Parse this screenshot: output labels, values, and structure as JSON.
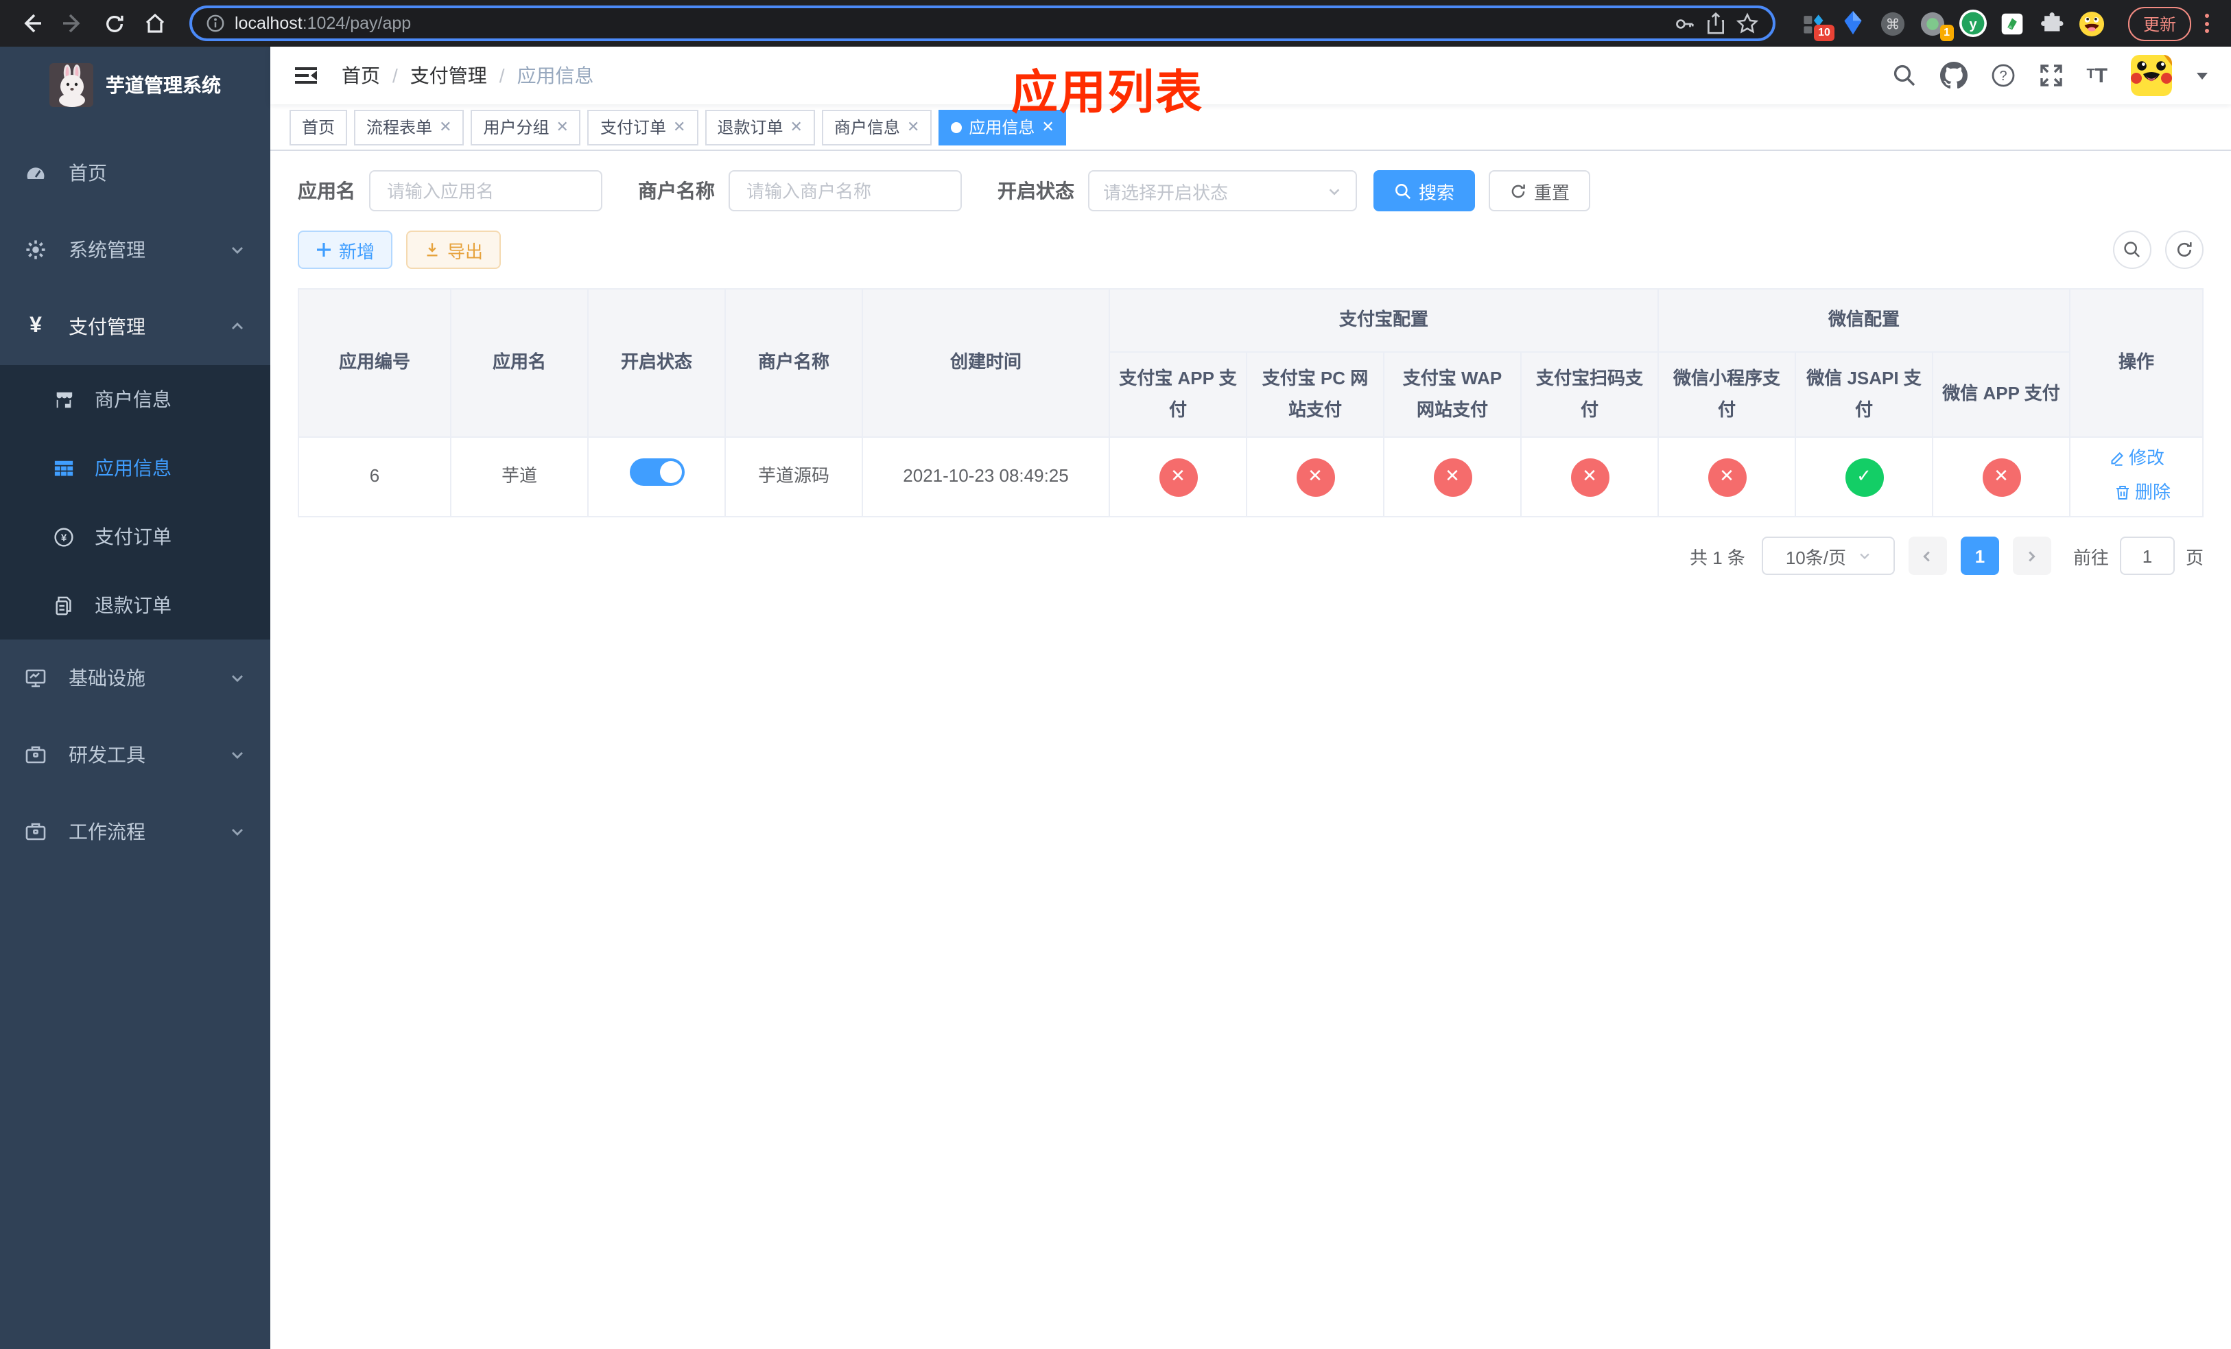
{
  "browser": {
    "url_host": "localhost",
    "url_path": ":1024/pay/app",
    "ext_badge_red": "10",
    "ext_badge_orange": "1",
    "update_label": "更新"
  },
  "sidebar": {
    "title": "芋道管理系统",
    "menu": [
      {
        "label": "首页",
        "icon": "dashboard-icon"
      },
      {
        "label": "系统管理",
        "icon": "gear-icon"
      },
      {
        "label": "支付管理",
        "icon": "yen-icon"
      },
      {
        "label": "基础设施",
        "icon": "monitor-icon"
      },
      {
        "label": "研发工具",
        "icon": "briefcase-icon"
      },
      {
        "label": "工作流程",
        "icon": "briefcase-icon"
      }
    ],
    "submenu": [
      {
        "label": "商户信息",
        "icon": "store-icon"
      },
      {
        "label": "应用信息",
        "icon": "grid-icon",
        "active": true
      },
      {
        "label": "支付订单",
        "icon": "yen-circle-icon"
      },
      {
        "label": "退款订单",
        "icon": "documents-icon"
      }
    ]
  },
  "navbar": {
    "breadcrumb": [
      "首页",
      "支付管理",
      "应用信息"
    ],
    "annotation": "应用列表"
  },
  "tabs": [
    {
      "label": "首页",
      "closable": false,
      "active": false
    },
    {
      "label": "流程表单",
      "closable": true,
      "active": false
    },
    {
      "label": "用户分组",
      "closable": true,
      "active": false
    },
    {
      "label": "支付订单",
      "closable": true,
      "active": false
    },
    {
      "label": "退款订单",
      "closable": true,
      "active": false
    },
    {
      "label": "商户信息",
      "closable": true,
      "active": false
    },
    {
      "label": "应用信息",
      "closable": true,
      "active": true
    }
  ],
  "filters": {
    "app_name_label": "应用名",
    "app_name_placeholder": "请输入应用名",
    "merchant_label": "商户名称",
    "merchant_placeholder": "请输入商户名称",
    "status_label": "开启状态",
    "status_placeholder": "请选择开启状态",
    "search_label": "搜索",
    "reset_label": "重置"
  },
  "toolbar": {
    "add_label": "新增",
    "export_label": "导出"
  },
  "table": {
    "columns": {
      "app_id": "应用编号",
      "app_name": "应用名",
      "open_status": "开启状态",
      "merchant_name": "商户名称",
      "create_time": "创建时间",
      "alipay_group": "支付宝配置",
      "wechat_group": "微信配置",
      "actions": "操作",
      "alipay_app": "支付宝 APP 支付",
      "alipay_pc": "支付宝 PC 网站支付",
      "alipay_wap": "支付宝 WAP 网站支付",
      "alipay_qr": "支付宝扫码支付",
      "wx_mini": "微信小程序支付",
      "wx_jsapi": "微信 JSAPI 支付",
      "wx_app": "微信 APP 支付"
    },
    "row": {
      "app_id": "6",
      "app_name": "芋道",
      "switch_on": true,
      "merchant_name": "芋道源码",
      "create_time": "2021-10-23 08:49:25",
      "statuses": [
        "x",
        "x",
        "x",
        "x",
        "x",
        "check",
        "x"
      ],
      "edit_label": "修改",
      "delete_label": "删除"
    }
  },
  "pagination": {
    "total": "共 1 条",
    "page_size": "10条/页",
    "current_page": "1",
    "goto_label": "前往",
    "goto_value": "1",
    "page_unit": "页"
  },
  "colors": {
    "primary": "#409eff",
    "danger": "#f56c6c",
    "success": "#13ce66",
    "warning": "#e6a23c",
    "sidebar_bg": "#304156",
    "submenu_bg": "#1f2d3d",
    "annotation_red": "#ff2d00"
  }
}
